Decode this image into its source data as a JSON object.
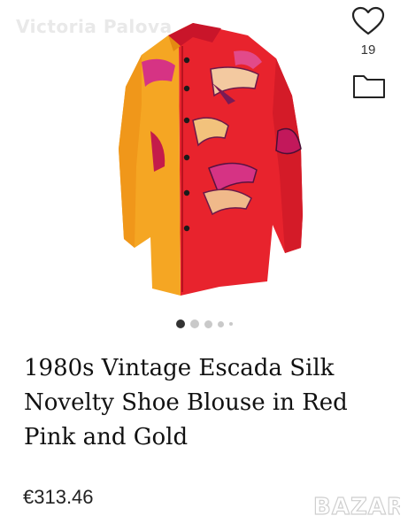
{
  "watermark": "Victoria Palova",
  "favorite": {
    "icon": "heart-icon",
    "count": "19"
  },
  "collection": {
    "icon": "folder-icon"
  },
  "gallery": {
    "total_images": 5,
    "active_index": 0
  },
  "product": {
    "title": "1980s Vintage Escada Silk Novelty Shoe Blouse in Red Pink and Gold",
    "price": "€313.46"
  },
  "brand": {
    "logo_text": "BAZAR"
  },
  "colors": {
    "blouse_red": "#e8232d",
    "blouse_gold": "#f5a623",
    "accent_pink": "#d63384",
    "text": "#111111"
  }
}
